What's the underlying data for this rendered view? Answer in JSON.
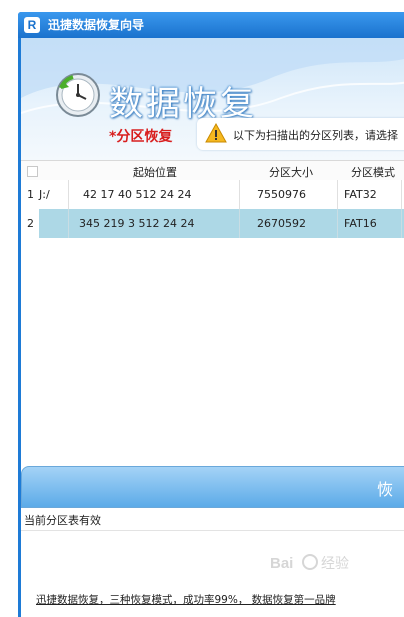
{
  "app": {
    "title": "迅捷数据恢复向导",
    "icon_letter": "R"
  },
  "banner": {
    "title": "数据恢复",
    "crumb": "*分区恢复",
    "notice": "以下为扫描出的分区列表，请选择"
  },
  "table": {
    "columns": [
      "起始位置",
      "分区大小",
      "分区模式"
    ],
    "rows": [
      {
        "index": "1",
        "drive": "J:/",
        "start": "42  17 40   512  24 24",
        "size": "7550976",
        "mode": "FAT32",
        "selected": false
      },
      {
        "index": "2",
        "drive": "",
        "start": "345 219  3   512  24 24",
        "size": "2670592",
        "mode": "FAT16",
        "selected": true
      }
    ]
  },
  "status": {
    "button_label": "恢",
    "message": "当前分区表有效",
    "ad_text": "迅捷数据恢复，三种恢复模式，成功率99%， 数据恢复第一品牌"
  },
  "watermark": {
    "text": "Baidu经验"
  },
  "colors": {
    "title_bar": "#1a72cd",
    "selected_row": "#add8e6",
    "crumb_red": "#d81e1e",
    "status_bar": "#5cabe8"
  }
}
